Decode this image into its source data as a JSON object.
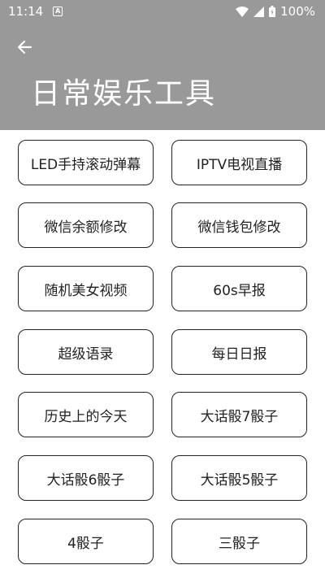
{
  "status_bar": {
    "time": "11:14",
    "battery": "100%",
    "notification_icon": "A"
  },
  "header": {
    "title": "日常娱乐工具",
    "back_icon": "arrow-left-icon"
  },
  "tools": [
    "LED手持滚动弹幕",
    "IPTV电视直播",
    "微信余额修改",
    "微信钱包修改",
    "随机美女视频",
    "60s早报",
    "超级语录",
    "每日日报",
    "历史上的今天",
    "大话骰7骰子",
    "大话骰6骰子",
    "大话骰5骰子",
    "4骰子",
    "三骰子"
  ],
  "colors": {
    "header_bg": "#999999",
    "button_border": "#222222"
  }
}
